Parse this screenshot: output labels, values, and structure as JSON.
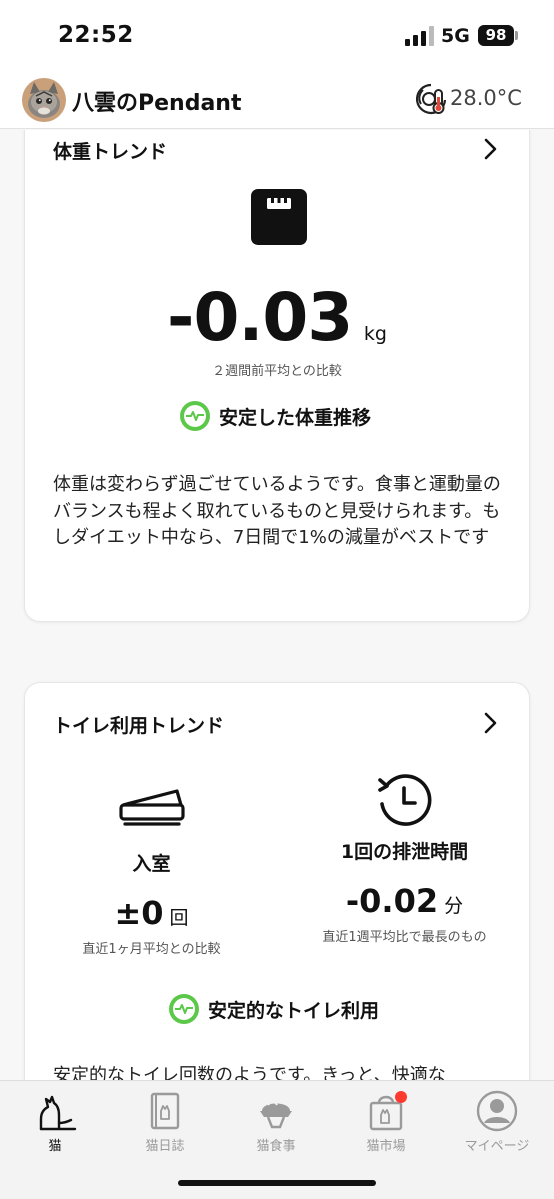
{
  "status_bar": {
    "time": "22:52",
    "network": "5G",
    "battery": "98"
  },
  "header": {
    "pet_name": "八雲のPendant",
    "temperature": "28.0°C"
  },
  "weight_card": {
    "title": "体重トレンド",
    "value": "-0.03",
    "unit": "kg",
    "caption": "２週間前平均との比較",
    "status": "安定した体重推移",
    "description": "体重は変わらず過ごせているようです。食事と運動量のバランスも程よく取れているものと見受けられます。もしダイエット中なら、7日間で1%の減量がベストです"
  },
  "toilet_card": {
    "title": "トイレ利用トレンド",
    "entry": {
      "label": "入室",
      "value": "±0",
      "unit": "回",
      "caption": "直近1ヶ月平均との比較"
    },
    "duration": {
      "label": "1回の排泄時間",
      "value": "-0.02",
      "unit": "分",
      "caption": "直近1週平均比で最長のもの"
    },
    "status": "安定的なトイレ利用",
    "description": "安定的なトイレ回数のようです。きっと、快適な"
  },
  "tabs": [
    {
      "label": "猫",
      "icon": "cat-icon",
      "active": true
    },
    {
      "label": "猫日誌",
      "icon": "journal-icon",
      "active": false
    },
    {
      "label": "猫食事",
      "icon": "food-bowl-icon",
      "active": false
    },
    {
      "label": "猫市場",
      "icon": "shopping-bag-icon",
      "active": false,
      "badge": true
    },
    {
      "label": "マイページ",
      "icon": "person-icon",
      "active": false
    }
  ],
  "colors": {
    "accent_green": "#5cc84a",
    "badge_red": "#ff3b30"
  }
}
